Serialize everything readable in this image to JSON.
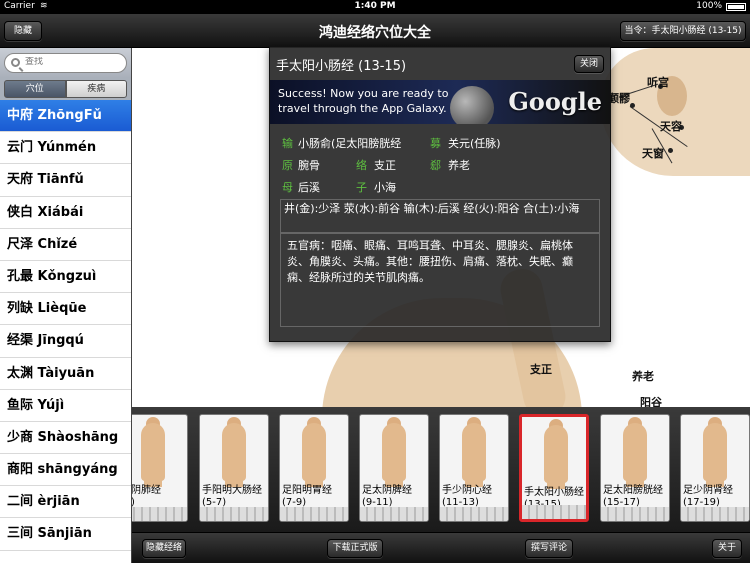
{
  "status": {
    "carrier": "Carrier",
    "wifi": "≋",
    "time": "1:40 PM",
    "battery": "100%"
  },
  "nav": {
    "title": "鸿迪经络穴位大全",
    "hide_label": "隐藏",
    "current_label": "当令：手太阳小肠经 (13-15)"
  },
  "sidebar": {
    "search_placeholder": "查找",
    "segments": [
      "穴位",
      "疾病"
    ],
    "items": [
      "中府 ZhōngFǔ",
      "云门 Yúnmén",
      "天府 Tiānfǔ",
      "侠白 Xiábái",
      "尺泽 Chǐzé",
      "孔最 Kǒngzuì",
      "列缺 Lièqūe",
      "经渠 Jīngqú",
      "太渊 Tàiyuān",
      "鱼际 Yújì",
      "少商 Shàoshāng",
      "商阳 shāngyáng",
      "二间 èrjiān",
      "三间 Sānjiān"
    ]
  },
  "figure": {
    "labels": [
      "听宫",
      "颧髎",
      "天容",
      "天窗",
      "支正",
      "养老",
      "阳谷"
    ]
  },
  "popover": {
    "title": "手太阳小肠经 (13-15)",
    "close_label": "关闭",
    "ad_line1": "Success! Now you are ready to",
    "ad_line2": "travel through the App Galaxy.",
    "ad_logo": "Google",
    "rows": [
      {
        "k1": "输",
        "v1": "小肠俞(足太阳膀胱经",
        "k2": "募",
        "v2": "关元(任脉)"
      },
      {
        "k1": "原",
        "v1": "腕骨",
        "k2": "络",
        "v2": "支正",
        "k3": "郄",
        "v3": "养老"
      },
      {
        "k1": "母",
        "v1": "后溪",
        "k2": "子",
        "v2": "小海"
      }
    ],
    "points": "井(金):少泽  荥(水):前谷  输(木):后溪  经(火):阳谷  合(土):小海",
    "diseases": "五官病：咽痛、眼痛、耳鸣耳聋、中耳炎、腮腺炎、扁桃体炎、角膜炎、头痛。其他：腰扭伤、肩痛、落枕、失眠、癫痫、经脉所过的关节肌肉痛。"
  },
  "thumbs": [
    {
      "line1": "太阴肺经",
      "line2": "-5)"
    },
    {
      "line1": "手阳明大肠经",
      "line2": "(5-7)"
    },
    {
      "line1": "足阳明胃经",
      "line2": "(7-9)"
    },
    {
      "line1": "足太阴脾经",
      "line2": "(9-11)"
    },
    {
      "line1": "手少阴心经",
      "line2": "(11-13)"
    },
    {
      "line1": "手太阳小肠经",
      "line2": "(13-15)"
    },
    {
      "line1": "足太阳膀胱经",
      "line2": "(15-17)"
    },
    {
      "line1": "足少阴肾经",
      "line2": "(17-19)"
    }
  ],
  "toolbar": {
    "hide_meridian": "隐藏经络",
    "download": "下载正式版",
    "review": "撰写评论",
    "about": "关于"
  }
}
